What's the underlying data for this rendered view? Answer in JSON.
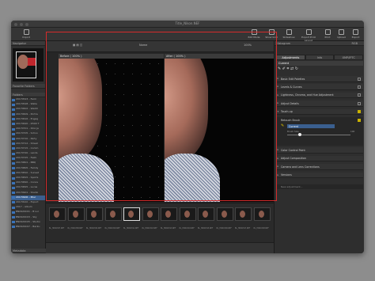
{
  "window": {
    "title": "Title_Nikon.NEF"
  },
  "toolbar": {
    "left": [
      {
        "label": "Import",
        "icon": "import-icon"
      }
    ],
    "right": [
      {
        "label": "Edit Mode",
        "icon": "edit-icon"
      },
      {
        "label": "Show Grid",
        "icon": "grid-icon"
      },
      {
        "label": "Slideshow",
        "icon": "slideshow-icon"
      },
      {
        "label": "Export Print Layout",
        "icon": "print-layout-icon"
      },
      {
        "label": "Print",
        "icon": "print-icon"
      },
      {
        "label": "Upload",
        "icon": "upload-icon"
      },
      {
        "label": "Export",
        "icon": "export-icon"
      }
    ]
  },
  "left_panel": {
    "navigator": "Navigator",
    "favorites": "Favorite Folders",
    "folders_title": "Folders",
    "folders": [
      "20170523 – Farm",
      "20170528 – Walle",
      "20170602 – Weddi",
      "20170609 – Portra",
      "20170616 – Engag",
      "20170620 – D500 T",
      "20170701 – DCA Ja",
      "20170705 – Schoo",
      "20170710 – Party",
      "20170712 – Street",
      "20170715 – Comm",
      "20170720 – Lands",
      "20170725 – Fashi",
      "20170801 – BBQ",
      "20170805 – Family",
      "20170810 – Sunset",
      "20170815 – Sports",
      "20170820 – Conce",
      "20170825 – Lucas",
      "20170901 – Studio",
      "20170906 – Misc",
      "20170910 – Export",
      "2017 – Album",
      "BN0920C01 – B Lor",
      "BN0920C03 – Sky",
      "BN0920C05 – Studio",
      "BN0920C07 – Backu"
    ],
    "selected_folder": 20,
    "metadata": "Metadata"
  },
  "viewer": {
    "zoom": "100%",
    "view_name": "Name",
    "before_label": "Before ( 100% )",
    "after_label": "After ( 100% )"
  },
  "filmstrip": [
    "BL_HDR0387.NEF",
    "BL_HDR0388.NEF",
    "BL_HDR0389.NEF",
    "BL_HDR0390.NEF",
    "BL_HDR0391.NEF",
    "BL_HDR0392.NEF",
    "BL_HDR0393.NEF",
    "BL_HDR0394.NEF",
    "BL_HDR0395.NEF",
    "BL_HDR0396.NEF",
    "BL_HDR0397.NEF",
    "BL_HDR0398.NEF"
  ],
  "selected_thumb": 4,
  "right_panel": {
    "histogram": "Histogram",
    "histogram_mode": "RGB",
    "tabs": [
      "Adjustments",
      "Info",
      "XMP/IPTC"
    ],
    "active_tab": 0,
    "current": "Current",
    "sections": [
      "Basic Edit Palettes",
      "Levels & Curves",
      "Lightness, Chroma, and Hue Adjustment",
      "Adjust Details",
      "Touch-up"
    ],
    "retouch_brush": "Retouch Brush",
    "brush_current": "Current",
    "brush_size_label": "Brush Size",
    "brush_size_value": "100",
    "brush_size_level": 0.2,
    "sections_after": [
      "Color Control Point",
      "Adjust Composition",
      "Camera and Lens Corrections",
      "Versions"
    ],
    "new_adjustment": "New adjustment..."
  },
  "colors": {
    "accent": "#d42b2b",
    "selection": "#3a5f8f",
    "check": "#c9b100"
  }
}
